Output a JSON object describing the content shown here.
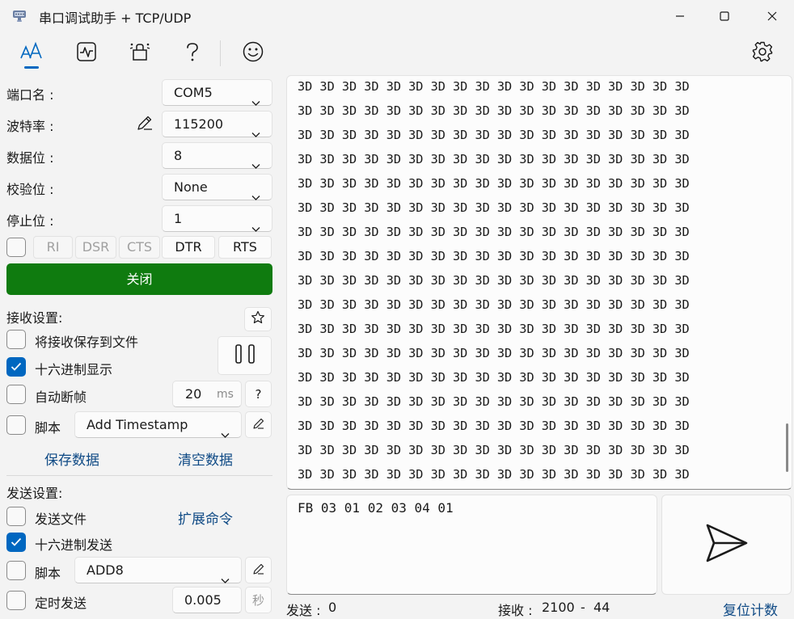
{
  "window": {
    "title": "串口调试助手 + TCP/UDP",
    "icons": [
      "serial-port-icon",
      "minimize-icon",
      "maximize-icon",
      "close-icon"
    ]
  },
  "toolbar": {
    "icons": [
      "text-format-icon",
      "waveform-icon",
      "plugins-icon",
      "help-icon",
      "smiley-icon",
      "settings-icon"
    ]
  },
  "port_settings": {
    "port_label": "端口名 :",
    "port_value": "COM5",
    "baud_label": "波特率 :",
    "baud_value": "115200",
    "databits_label": "数据位 :",
    "databits_value": "8",
    "parity_label": "校验位 :",
    "parity_value": "None",
    "stopbits_label": "停止位 :",
    "stopbits_value": "1",
    "signals": [
      "RI",
      "DSR",
      "CTS",
      "DTR",
      "RTS"
    ],
    "open_close_label": "关闭",
    "accent_color": "#0f7b0f"
  },
  "receive": {
    "section_label": "接收设置:",
    "save_to_file_label": "将接收保存到文件",
    "save_to_file_checked": false,
    "hex_display_label": "十六进制显示",
    "hex_display_checked": true,
    "auto_frame_label": "自动断帧",
    "auto_frame_checked": false,
    "auto_frame_value": "20",
    "auto_frame_unit": "ms",
    "auto_frame_help": "?",
    "script_label": "脚本",
    "script_checked": false,
    "script_value": "Add Timestamp",
    "save_data_label": "保存数据",
    "clear_data_label": "清空数据",
    "paused": false
  },
  "send": {
    "section_label": "发送设置:",
    "send_file_label": "发送文件",
    "send_file_checked": false,
    "extended_commands_label": "扩展命令",
    "hex_send_label": "十六进制发送",
    "hex_send_checked": true,
    "script_label": "脚本",
    "script_checked": false,
    "script_value": "ADD8",
    "timed_send_label": "定时发送",
    "timed_send_checked": false,
    "timed_send_value": "0.005",
    "timed_send_unit": "秒",
    "input_text": "FB 03 01 02 03 04 01"
  },
  "receive_area": {
    "text": "3D 3D 3D 3D 3D 3D 3D 3D 3D 3D 3D 3D 3D 3D 3D 3D 3D 3D\n3D 3D 3D 3D 3D 3D 3D 3D 3D 3D 3D 3D 3D 3D 3D 3D 3D 3D\n3D 3D 3D 3D 3D 3D 3D 3D 3D 3D 3D 3D 3D 3D 3D 3D 3D 3D\n3D 3D 3D 3D 3D 3D 3D 3D 3D 3D 3D 3D 3D 3D 3D 3D 3D 3D\n3D 3D 3D 3D 3D 3D 3D 3D 3D 3D 3D 3D 3D 3D 3D 3D 3D 3D\n3D 3D 3D 3D 3D 3D 3D 3D 3D 3D 3D 3D 3D 3D 3D 3D 3D 3D\n3D 3D 3D 3D 3D 3D 3D 3D 3D 3D 3D 3D 3D 3D 3D 3D 3D 3D\n3D 3D 3D 3D 3D 3D 3D 3D 3D 3D 3D 3D 3D 3D 3D 3D 3D 3D\n3D 3D 3D 3D 3D 3D 3D 3D 3D 3D 3D 3D 3D 3D 3D 3D 3D 3D\n3D 3D 3D 3D 3D 3D 3D 3D 3D 3D 3D 3D 3D 3D 3D 3D 3D 3D\n3D 3D 3D 3D 3D 3D 3D 3D 3D 3D 3D 3D 3D 3D 3D 3D 3D 3D\n3D 3D 3D 3D 3D 3D 3D 3D 3D 3D 3D 3D 3D 3D 3D 3D 3D 3D\n3D 3D 3D 3D 3D 3D 3D 3D 3D 3D 3D 3D 3D 3D 3D 3D 3D 3D\n3D 3D 3D 3D 3D 3D 3D 3D 3D 3D 3D 3D 3D 3D 3D 3D 3D 3D\n3D 3D 3D 3D 3D 3D 3D 3D 3D 3D 3D 3D 3D 3D 3D 3D 3D 3D\n3D 3D 3D 3D 3D 3D 3D 3D 3D 3D 3D 3D 3D 3D 3D 3D 3D 3D\n3D 3D 3D 3D 3D 3D 3D 3D 3D 3D 3D 3D 3D 3D 3D 3D 3D 3D\n3D 3D 3D 3D 3D 3D 3D 3D 3D 3D 3D"
  },
  "status_bar": {
    "sent_label": "发送 :",
    "sent_value": "0",
    "received_label": "接收 :",
    "received_value": "2100",
    "received_separator": "-",
    "received_extra": "44",
    "reset_label": "复位计数"
  }
}
